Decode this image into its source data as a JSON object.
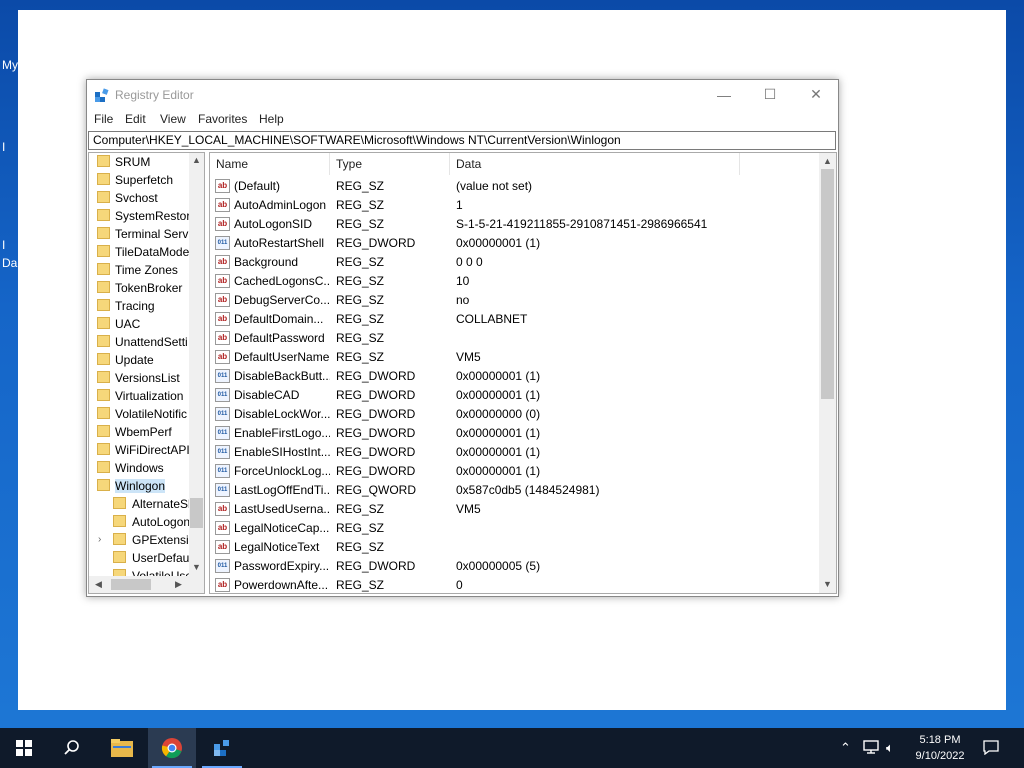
{
  "desktop": {
    "labels": [
      "My",
      "I",
      "I",
      "Da"
    ]
  },
  "window": {
    "title": "Registry Editor",
    "controls": {
      "minimize": "—",
      "maximize": "☐",
      "close": "✕"
    },
    "menu": [
      "File",
      "Edit",
      "View",
      "Favorites",
      "Help"
    ],
    "address": "Computer\\HKEY_LOCAL_MACHINE\\SOFTWARE\\Microsoft\\Windows NT\\CurrentVersion\\Winlogon"
  },
  "tree": {
    "items": [
      {
        "label": "SRUM"
      },
      {
        "label": "Superfetch"
      },
      {
        "label": "Svchost"
      },
      {
        "label": "SystemRestor"
      },
      {
        "label": "Terminal Serv"
      },
      {
        "label": "TileDataMode"
      },
      {
        "label": "Time Zones"
      },
      {
        "label": "TokenBroker"
      },
      {
        "label": "Tracing"
      },
      {
        "label": "UAC"
      },
      {
        "label": "UnattendSetti"
      },
      {
        "label": "Update"
      },
      {
        "label": "VersionsList"
      },
      {
        "label": "Virtualization"
      },
      {
        "label": "VolatileNotific"
      },
      {
        "label": "WbemPerf"
      },
      {
        "label": "WiFiDirectAPI"
      },
      {
        "label": "Windows"
      },
      {
        "label": "Winlogon"
      }
    ],
    "children": [
      {
        "label": "AlternateSh"
      },
      {
        "label": "AutoLogon"
      },
      {
        "label": "GPExtensio"
      },
      {
        "label": "UserDefaul"
      },
      {
        "label": "VolatileUse"
      }
    ]
  },
  "list": {
    "columns": [
      "Name",
      "Type",
      "Data"
    ],
    "rows": [
      {
        "icon": "ab",
        "name": "(Default)",
        "type": "REG_SZ",
        "data": "(value not set)"
      },
      {
        "icon": "ab",
        "name": "AutoAdminLogon",
        "type": "REG_SZ",
        "data": "1"
      },
      {
        "icon": "ab",
        "name": "AutoLogonSID",
        "type": "REG_SZ",
        "data": "S-1-5-21-419211855-2910871451-2986966541"
      },
      {
        "icon": "bin",
        "name": "AutoRestartShell",
        "type": "REG_DWORD",
        "data": "0x00000001 (1)"
      },
      {
        "icon": "ab",
        "name": "Background",
        "type": "REG_SZ",
        "data": "0 0 0"
      },
      {
        "icon": "ab",
        "name": "CachedLogonsC...",
        "type": "REG_SZ",
        "data": "10"
      },
      {
        "icon": "ab",
        "name": "DebugServerCo...",
        "type": "REG_SZ",
        "data": "no"
      },
      {
        "icon": "ab",
        "name": "DefaultDomain...",
        "type": "REG_SZ",
        "data": "COLLABNET"
      },
      {
        "icon": "ab",
        "name": "DefaultPassword",
        "type": "REG_SZ",
        "data": ""
      },
      {
        "icon": "ab",
        "name": "DefaultUserName",
        "type": "REG_SZ",
        "data": "VM5"
      },
      {
        "icon": "bin",
        "name": "DisableBackButt...",
        "type": "REG_DWORD",
        "data": "0x00000001 (1)"
      },
      {
        "icon": "bin",
        "name": "DisableCAD",
        "type": "REG_DWORD",
        "data": "0x00000001 (1)"
      },
      {
        "icon": "bin",
        "name": "DisableLockWor...",
        "type": "REG_DWORD",
        "data": "0x00000000 (0)"
      },
      {
        "icon": "bin",
        "name": "EnableFirstLogo...",
        "type": "REG_DWORD",
        "data": "0x00000001 (1)"
      },
      {
        "icon": "bin",
        "name": "EnableSIHostInt...",
        "type": "REG_DWORD",
        "data": "0x00000001 (1)"
      },
      {
        "icon": "bin",
        "name": "ForceUnlockLog...",
        "type": "REG_DWORD",
        "data": "0x00000001 (1)"
      },
      {
        "icon": "bin",
        "name": "LastLogOffEndTi...",
        "type": "REG_QWORD",
        "data": "0x587c0db5 (1484524981)"
      },
      {
        "icon": "ab",
        "name": "LastUsedUserna...",
        "type": "REG_SZ",
        "data": "VM5"
      },
      {
        "icon": "ab",
        "name": "LegalNoticeCap...",
        "type": "REG_SZ",
        "data": ""
      },
      {
        "icon": "ab",
        "name": "LegalNoticeText",
        "type": "REG_SZ",
        "data": ""
      },
      {
        "icon": "bin",
        "name": "PasswordExpiry...",
        "type": "REG_DWORD",
        "data": "0x00000005 (5)"
      },
      {
        "icon": "ab",
        "name": "PowerdownAfte...",
        "type": "REG_SZ",
        "data": "0"
      }
    ]
  },
  "taskbar": {
    "time": "5:18 PM",
    "date": "9/10/2022",
    "icons": [
      "windows-start-icon",
      "search-icon",
      "file-explorer-icon",
      "chrome-icon",
      "registry-editor-icon"
    ],
    "tray": [
      "chevron-up-icon",
      "network-icon",
      "volume-icon",
      "notification-icon"
    ]
  },
  "colors": {
    "accent": "#0078d7",
    "taskbar": "#0f1a2a",
    "folder": "#f6d77a",
    "selection": "#cce4f7"
  }
}
